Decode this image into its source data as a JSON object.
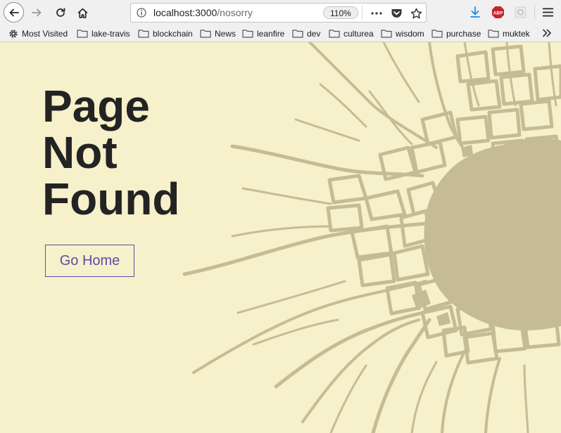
{
  "browser": {
    "url_host": "localhost:3000",
    "url_path": "/nosorry",
    "zoom": "110%",
    "icons": [
      "back-arrow-icon",
      "forward-arrow-icon",
      "reload-icon",
      "home-icon",
      "info-icon",
      "more-dots-icon",
      "pocket-icon",
      "star-icon",
      "download-icon",
      "abp-icon",
      "extension-icon",
      "hamburger-menu-icon"
    ],
    "abp_label": "ABP"
  },
  "bookmarks": [
    {
      "label": "Most Visited",
      "icon": "gear-icon"
    },
    {
      "label": "lake-travis",
      "icon": "folder-icon"
    },
    {
      "label": "blockchain",
      "icon": "folder-icon"
    },
    {
      "label": "News",
      "icon": "folder-icon"
    },
    {
      "label": "leanfire",
      "icon": "folder-icon"
    },
    {
      "label": "dev",
      "icon": "folder-icon"
    },
    {
      "label": "culturea",
      "icon": "folder-icon"
    },
    {
      "label": "wisdom",
      "icon": "folder-icon"
    },
    {
      "label": "purchase",
      "icon": "folder-icon"
    },
    {
      "label": "muktek",
      "icon": "folder-icon"
    }
  ],
  "page": {
    "title_lines": [
      "Page",
      "Not",
      "Found"
    ],
    "go_home_label": "Go Home"
  },
  "colors": {
    "background": "#f6f0cb",
    "crack": "#c5bc95",
    "title": "#232323",
    "button": "#5b4ea3"
  }
}
